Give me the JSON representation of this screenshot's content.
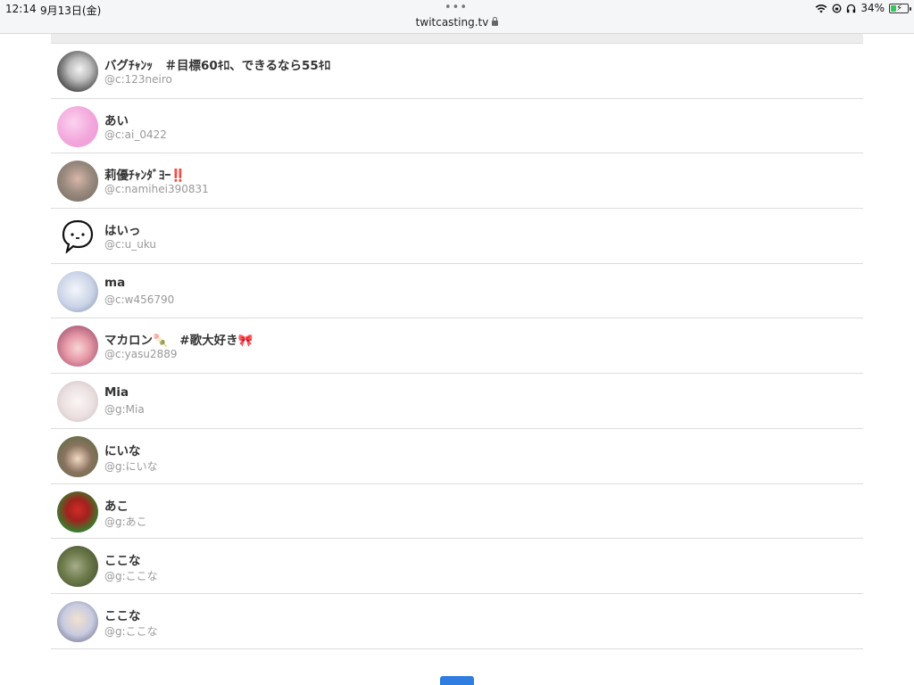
{
  "status_bar": {
    "time": "12:14",
    "date": "9月13日(金)",
    "url": "twitcasting.tv",
    "battery_pct": "34%",
    "battery_level": 0.34,
    "battery_color": "#35c759"
  },
  "users": [
    {
      "name": "バグﾁｬﾝｯ　＃目標60ｷﾛ、できるなら55ｷﾛ",
      "id": "@c:123neiro",
      "avatar_color": "#9a9a9a"
    },
    {
      "name": "あい",
      "id": "@c:ai_0422",
      "avatar_color": "#f4a9d8"
    },
    {
      "name": "莉優ﾁｬﾝﾀﾞﾖｰ‼️",
      "id": "@c:namihei390831",
      "avatar_color": "#8f8276"
    },
    {
      "name": "はいっ",
      "id": "@c:u_uku",
      "avatar_color": "#ffffff"
    },
    {
      "name": "ma",
      "id": "@c:w456790",
      "avatar_color": "#c9d3e6"
    },
    {
      "name": "マカロン🍡　#歌大好き🎀",
      "id": "@c:yasu2889",
      "avatar_color": "#c86b8e"
    },
    {
      "name": "Mia",
      "id": "@g:Mia",
      "avatar_color": "#eadfe0"
    },
    {
      "name": "にいな",
      "id": "@g:にいな",
      "avatar_color": "#6f5d4c"
    },
    {
      "name": "あこ",
      "id": "@g:あこ",
      "avatar_color": "#3c7a2e"
    },
    {
      "name": "ここな",
      "id": "@g:ここな",
      "avatar_color": "#5f6b3e"
    },
    {
      "name": "ここな",
      "id": "@g:ここな",
      "avatar_color": "#d9dbe6"
    }
  ]
}
